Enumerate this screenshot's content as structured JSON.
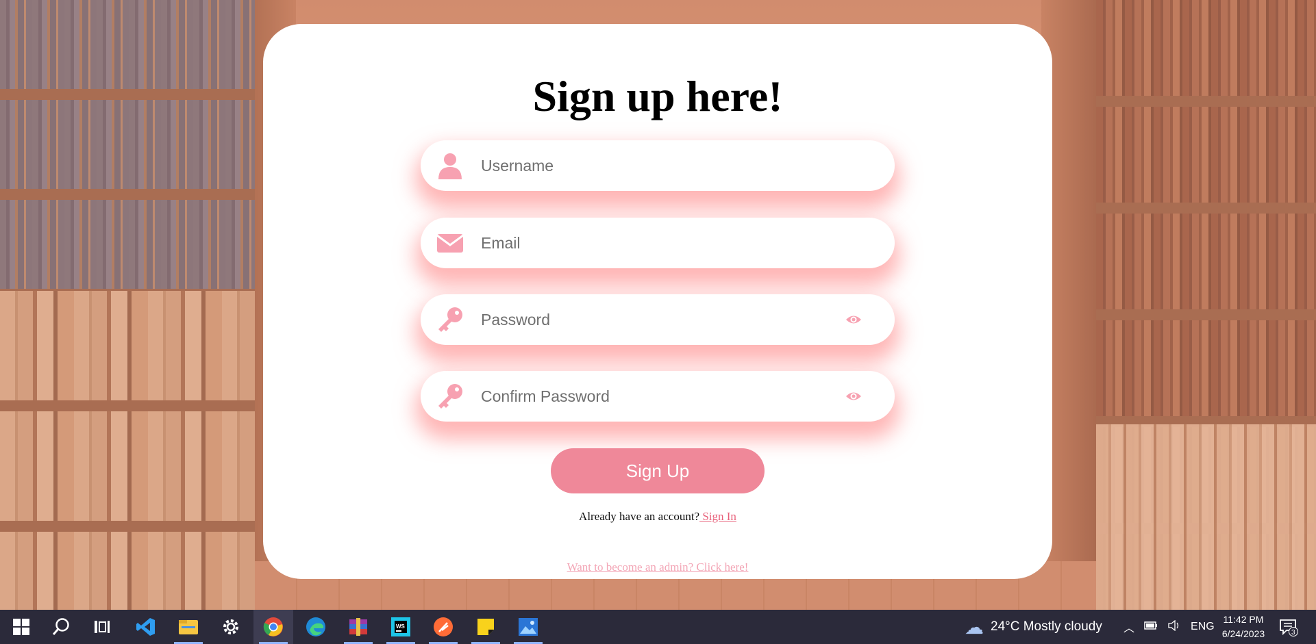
{
  "form": {
    "title": "Sign up here!",
    "username_placeholder": "Username",
    "email_placeholder": "Email",
    "password_placeholder": "Password",
    "confirm_password_placeholder": "Confirm Password",
    "submit_label": "Sign Up",
    "signin_prompt": "Already have an account?",
    "signin_link": " Sign In",
    "admin_link": "Want to become an admin? Click here!"
  },
  "colors": {
    "accent": "#ef8899",
    "icon": "#f7a1b1",
    "link": "#e8607a",
    "taskbar": "#2b2a3a"
  },
  "taskbar": {
    "apps": [
      "start-icon",
      "search-icon",
      "task-view-icon",
      "vscode-icon",
      "file-explorer-icon",
      "settings-icon",
      "chrome-icon",
      "edge-icon",
      "winrar-icon",
      "webstorm-icon",
      "postman-icon",
      "sticky-notes-icon",
      "photos-icon"
    ],
    "weather_temp": "24°C",
    "weather_text": "Mostly cloudy",
    "language": "ENG",
    "time": "11:42 PM",
    "date": "6/24/2023",
    "notification_count": "3"
  }
}
